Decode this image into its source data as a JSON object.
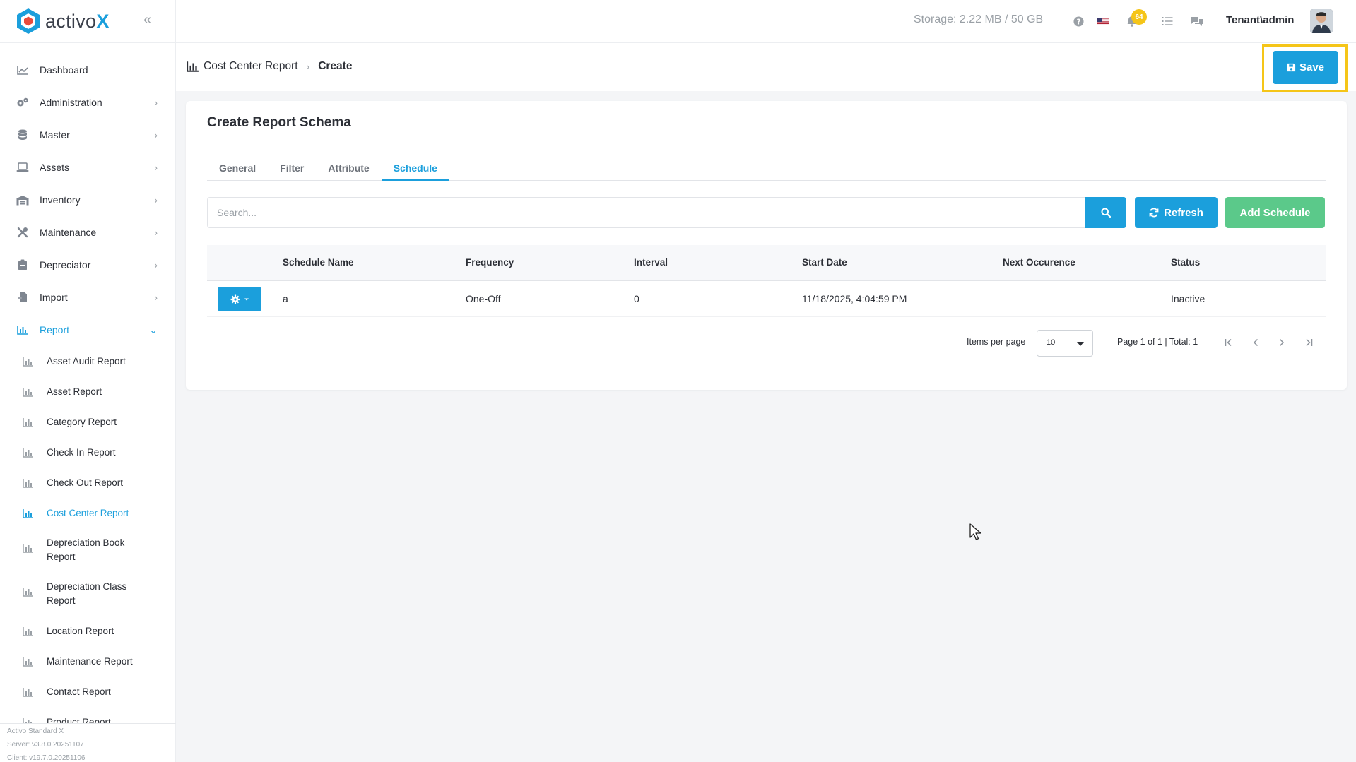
{
  "brand": {
    "name_prefix": "activo",
    "name_suffix": "X"
  },
  "sidebar": {
    "items": [
      {
        "label": "Dashboard",
        "icon": "chart-line-icon",
        "chevron": ""
      },
      {
        "label": "Administration",
        "icon": "gears-icon",
        "chevron": "›"
      },
      {
        "label": "Master",
        "icon": "database-icon",
        "chevron": "›"
      },
      {
        "label": "Assets",
        "icon": "laptop-icon",
        "chevron": "›"
      },
      {
        "label": "Inventory",
        "icon": "warehouse-icon",
        "chevron": "›"
      },
      {
        "label": "Maintenance",
        "icon": "tools-icon",
        "chevron": "›"
      },
      {
        "label": "Depreciator",
        "icon": "clipboard-icon",
        "chevron": "›"
      },
      {
        "label": "Import",
        "icon": "file-import-icon",
        "chevron": "›"
      },
      {
        "label": "Report",
        "icon": "chart-bar-icon",
        "chevron": "⌄"
      }
    ],
    "report_subitems": [
      "Asset Audit Report",
      "Asset Report",
      "Category Report",
      "Check In Report",
      "Check Out Report",
      "Cost Center Report",
      "Depreciation Book Report",
      "Depreciation Class Report",
      "Location Report",
      "Maintenance Report",
      "Contact Report",
      "Product Report"
    ],
    "version": {
      "product": "Activo Standard X",
      "server": "Server: v3.8.0.20251107",
      "client": "Client: v19.7.0.20251106"
    }
  },
  "topbar": {
    "storage": "Storage: 2.22 MB / 50 GB",
    "notification_count": "64",
    "user": "Tenant\\admin"
  },
  "breadcrumb": {
    "parent": "Cost Center Report",
    "current": "Create"
  },
  "actions": {
    "save_label": "Save"
  },
  "card": {
    "title": "Create Report Schema"
  },
  "tabs": [
    "General",
    "Filter",
    "Attribute",
    "Schedule"
  ],
  "active_tab": "Schedule",
  "search": {
    "placeholder": "Search...",
    "refresh_label": "Refresh",
    "add_label": "Add Schedule"
  },
  "table": {
    "columns": [
      "Schedule Name",
      "Frequency",
      "Interval",
      "Start Date",
      "Next Occurence",
      "Status"
    ],
    "rows": [
      {
        "schedule_name": "a",
        "frequency": "One-Off",
        "interval": "0",
        "start_date": "11/18/2025, 4:04:59 PM",
        "next_occurence": "",
        "status": "Inactive"
      }
    ]
  },
  "pagination": {
    "items_per_page_label": "Items per page",
    "items_per_page": "10",
    "info": "Page 1 of 1 | Total: 1"
  },
  "colors": {
    "accent": "#1b9fdc",
    "success": "#5bc98a",
    "highlight": "#f5c518"
  }
}
